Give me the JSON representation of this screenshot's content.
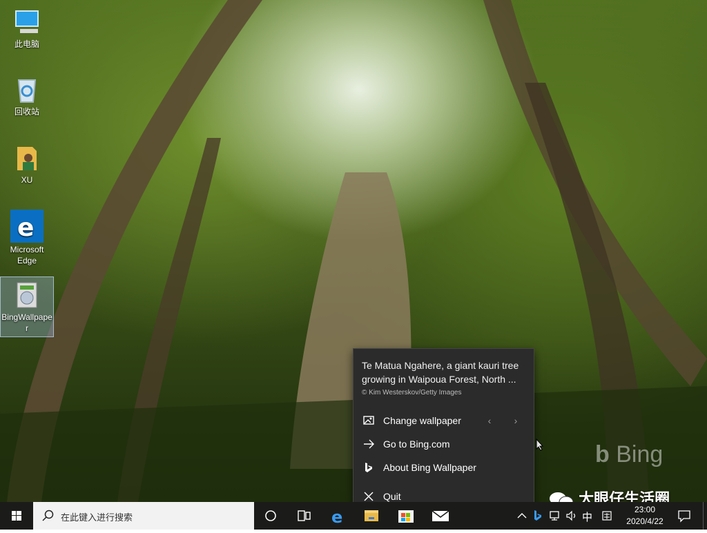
{
  "desktop": {
    "icons": [
      {
        "label": "此电脑",
        "icon": "computer-icon"
      },
      {
        "label": "回收站",
        "icon": "recycle-bin-icon"
      },
      {
        "label": "XU",
        "icon": "user-folder-icon"
      },
      {
        "label": "Microsoft Edge",
        "icon": "edge-icon"
      },
      {
        "label": "BingWallpaper",
        "icon": "bing-wallpaper-icon"
      }
    ],
    "watermark": "Bing",
    "overlay_text": "大眼仔生活圈"
  },
  "popup": {
    "description": "Te Matua Ngahere, a giant kauri tree growing in Waipoua Forest, North ...",
    "credit": "© Kim Westerskov/Getty Images",
    "menu": [
      {
        "label": "Change wallpaper",
        "icon": "image-icon"
      },
      {
        "label": "Go to Bing.com",
        "icon": "arrow-right-icon"
      },
      {
        "label": "About Bing Wallpaper",
        "icon": "bing-logo-icon"
      },
      {
        "label": "Quit",
        "icon": "close-icon"
      }
    ],
    "prev_glyph": "‹",
    "next_glyph": "›"
  },
  "taskbar": {
    "search_placeholder": "在此键入进行搜索",
    "ime_label": "中",
    "time": "23:00",
    "date": "2020/4/22",
    "accent": "#0a6fc2"
  }
}
